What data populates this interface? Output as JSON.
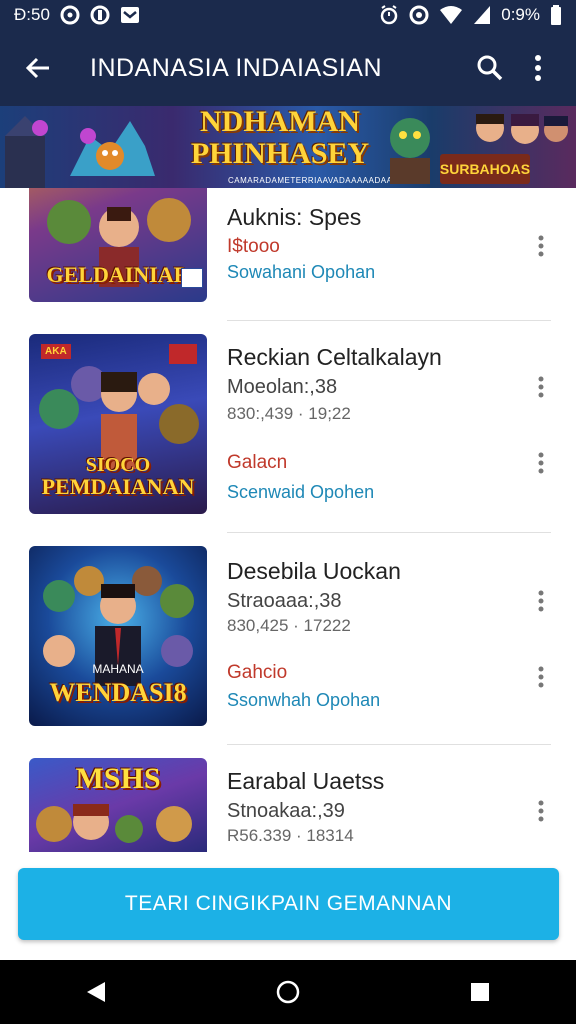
{
  "status_bar": {
    "time": "Đ:50",
    "battery": "0:9%"
  },
  "app_bar": {
    "title": "INDANASIA INDAIASIAN"
  },
  "banner": {
    "title_line1": "NDHAMAN",
    "title_line2": "PHINHASEY",
    "subtitle": "CAMARADAMETERRIAAVADAAAAADAABAAAA",
    "right_badge": "SURBAHOAS"
  },
  "items": [
    {
      "thumb_label": "GELDAINIAR",
      "name": "Auknis: Spes",
      "price": "I$tooo",
      "link": "Sowahani Opohan"
    },
    {
      "thumb_badge": "AKA",
      "thumb_label1": "SIOCO",
      "thumb_label2": "PEMDAIANAN",
      "name": "Reckian Celtalkalayn",
      "sub": "Moeolan:,38",
      "sub2": "830:,439 ·  19;22",
      "price": "Galacn",
      "link": "Scenwaid Opohen"
    },
    {
      "thumb_label": "WENDASI8",
      "thumb_label_small": "MAHANA",
      "name": "Desebila Uockan",
      "sub": "Straoaaa:,38",
      "sub2": "830,425 ·  17222",
      "price": "Gahcio",
      "link": "Ssonwhah Opohan"
    },
    {
      "thumb_label": "MSHS",
      "name": "Earabal Uaetss",
      "sub": "Stnoakaa:,39",
      "sub2": "R56.339 ·  18314"
    }
  ],
  "cta": {
    "label": "TEARI CINGIKPAIN GEMANNAN"
  },
  "colors": {
    "app_bar": "#1b2a4c",
    "accent": "#1cb1e6",
    "price": "#c0392b",
    "link": "#1e88b6"
  },
  "icons": {
    "back": "arrow-left-icon",
    "search": "search-icon",
    "overflow": "more-vert-icon",
    "nav_back": "triangle-back-icon",
    "nav_home": "circle-home-icon",
    "nav_recent": "square-recent-icon"
  }
}
